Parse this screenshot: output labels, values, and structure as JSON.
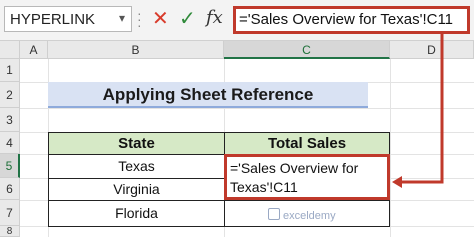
{
  "formula_bar": {
    "name_box": "HYPERLINK",
    "cancel_glyph": "✕",
    "enter_glyph": "✓",
    "fx_label": "fx",
    "formula": "='Sales Overview for Texas'!C11"
  },
  "columns": [
    "A",
    "B",
    "C",
    "D"
  ],
  "rows": [
    "1",
    "2",
    "3",
    "4",
    "5",
    "6",
    "7",
    "8"
  ],
  "selected": {
    "column": "C",
    "row": "5"
  },
  "title": "Applying Sheet Reference",
  "table": {
    "headers": [
      "State",
      "Total Sales"
    ],
    "rows": [
      {
        "state": "Texas",
        "sales": ""
      },
      {
        "state": "Virginia",
        "sales": ""
      },
      {
        "state": "Florida",
        "sales": ""
      }
    ]
  },
  "edit_cell": {
    "line1": "='Sales Overview for",
    "line2": "Texas'!C11"
  },
  "watermark": "exceldemy",
  "colors": {
    "accent_red": "#c0392b",
    "title_fill": "#d9e2f3",
    "header_fill": "#d6e9c6",
    "excel_green": "#217346"
  }
}
